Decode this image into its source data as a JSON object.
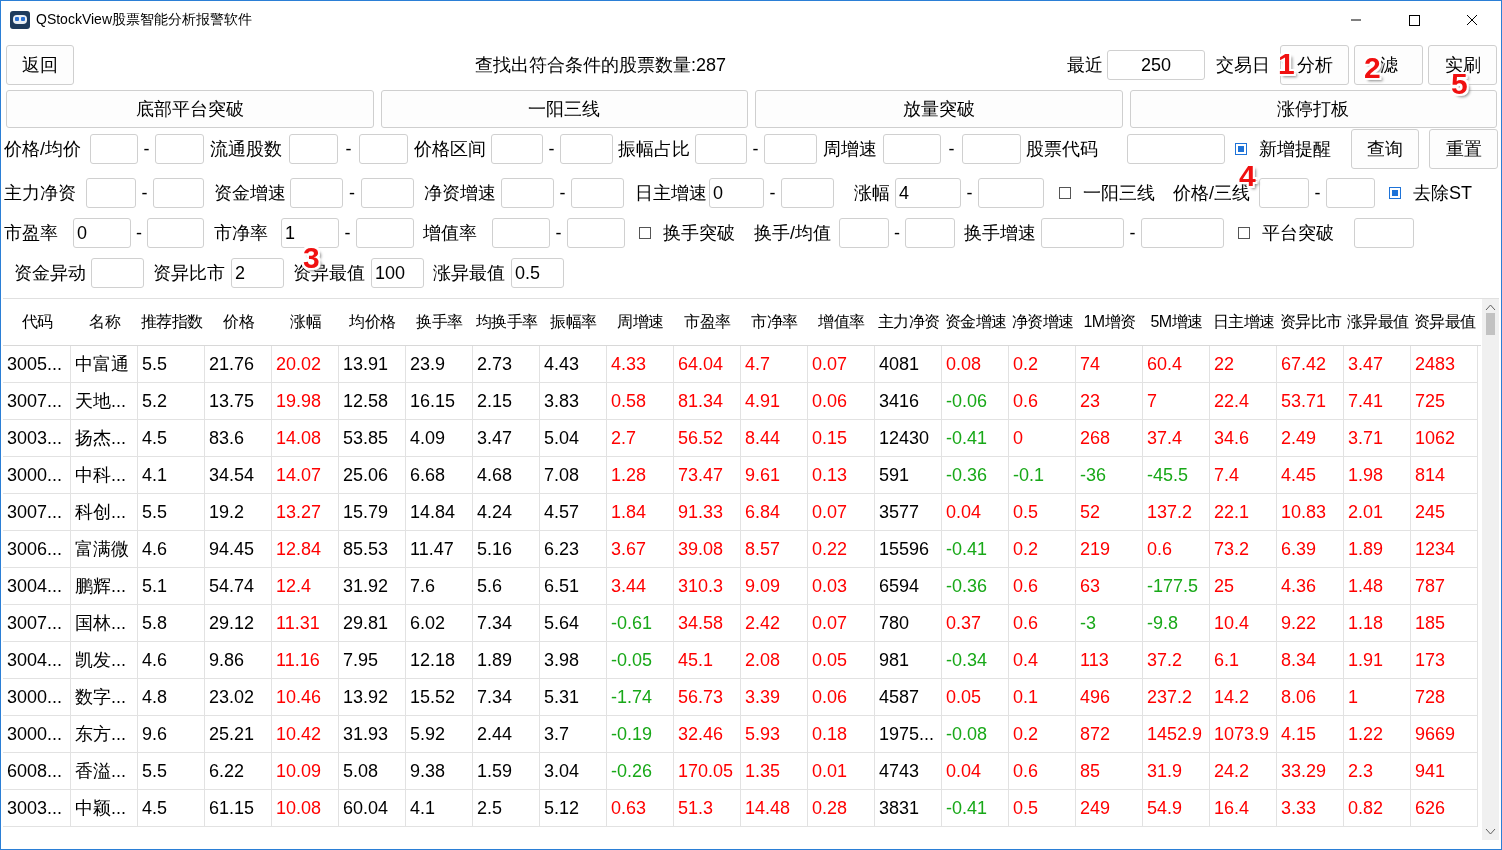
{
  "window": {
    "title": "QStockView股票智能分析报警软件"
  },
  "toolbar": {
    "back": "返回",
    "result": "查找出符合条件的股票数量:287",
    "recent_label": "最近",
    "recent_value": "250",
    "days_label": "交易日",
    "buttons": [
      "分析",
      "滤",
      "实刷"
    ]
  },
  "strategies": [
    "底部平台突破",
    "一阳三线",
    "放量突破",
    "涨停打板"
  ],
  "filters": [
    [
      {
        "kind": "label",
        "text": "价格/均价"
      },
      {
        "kind": "field"
      },
      {
        "kind": "dash",
        "text": "-"
      },
      {
        "kind": "field"
      },
      {
        "kind": "label",
        "text": "流通股数"
      },
      {
        "kind": "field"
      },
      {
        "kind": "dash",
        "text": "-"
      },
      {
        "kind": "field"
      },
      {
        "kind": "label",
        "text": "价格区间"
      },
      {
        "kind": "field"
      },
      {
        "kind": "dash",
        "text": "-"
      },
      {
        "kind": "field"
      },
      {
        "kind": "label",
        "text": "振幅占比"
      },
      {
        "kind": "field"
      },
      {
        "kind": "dash",
        "text": "-"
      },
      {
        "kind": "field"
      },
      {
        "kind": "label",
        "text": "周增速"
      },
      {
        "kind": "field"
      },
      {
        "kind": "dash",
        "text": "-"
      },
      {
        "kind": "field"
      },
      {
        "kind": "label",
        "text": "股票代码"
      },
      {
        "kind": "field"
      },
      {
        "kind": "check",
        "text": "新增提醒",
        "checked": true
      },
      {
        "kind": "button",
        "text": "查询"
      },
      {
        "kind": "button",
        "text": "重置"
      }
    ],
    [
      {
        "kind": "label",
        "text": "主力净资"
      },
      {
        "kind": "field"
      },
      {
        "kind": "dash",
        "text": "-"
      },
      {
        "kind": "field"
      },
      {
        "kind": "label",
        "text": "资金增速"
      },
      {
        "kind": "field"
      },
      {
        "kind": "dash",
        "text": "-"
      },
      {
        "kind": "field"
      },
      {
        "kind": "label",
        "text": "净资增速"
      },
      {
        "kind": "field"
      },
      {
        "kind": "dash",
        "text": "-"
      },
      {
        "kind": "field"
      },
      {
        "kind": "label",
        "text": "日主增速"
      },
      {
        "kind": "field",
        "value": "0"
      },
      {
        "kind": "dash",
        "text": "-"
      },
      {
        "kind": "field"
      },
      {
        "kind": "label",
        "text": "涨幅"
      },
      {
        "kind": "field",
        "value": "4"
      },
      {
        "kind": "dash",
        "text": "-"
      },
      {
        "kind": "field"
      },
      {
        "kind": "check",
        "text": "一阳三线",
        "checked": false
      },
      {
        "kind": "label",
        "text": "价格/三线"
      },
      {
        "kind": "field"
      },
      {
        "kind": "dash",
        "text": "-"
      },
      {
        "kind": "field"
      },
      {
        "kind": "check",
        "text": "去除ST",
        "checked": true
      }
    ],
    [
      {
        "kind": "label",
        "text": "市盈率"
      },
      {
        "kind": "field",
        "value": "0"
      },
      {
        "kind": "dash",
        "text": "-"
      },
      {
        "kind": "field"
      },
      {
        "kind": "label",
        "text": "市净率"
      },
      {
        "kind": "field",
        "value": "1"
      },
      {
        "kind": "dash",
        "text": "-"
      },
      {
        "kind": "field"
      },
      {
        "kind": "label",
        "text": "增值率"
      },
      {
        "kind": "field"
      },
      {
        "kind": "dash",
        "text": "-"
      },
      {
        "kind": "field"
      },
      {
        "kind": "check",
        "text": "换手突破",
        "checked": false
      },
      {
        "kind": "label",
        "text": "换手/均值"
      },
      {
        "kind": "field"
      },
      {
        "kind": "dash",
        "text": "-"
      },
      {
        "kind": "field"
      },
      {
        "kind": "label",
        "text": "换手增速"
      },
      {
        "kind": "field"
      },
      {
        "kind": "dash",
        "text": "-"
      },
      {
        "kind": "field"
      },
      {
        "kind": "check",
        "text": "平台突破",
        "checked": false
      },
      {
        "kind": "field"
      }
    ],
    [
      {
        "kind": "label",
        "text": "资金异动"
      },
      {
        "kind": "field"
      },
      {
        "kind": "label",
        "text": "资异比市"
      },
      {
        "kind": "field",
        "value": "2"
      },
      {
        "kind": "label",
        "text": "资异最值"
      },
      {
        "kind": "field",
        "value": "100"
      },
      {
        "kind": "label",
        "text": "涨异最值"
      },
      {
        "kind": "field",
        "value": "0.5"
      }
    ]
  ],
  "table": {
    "columns": [
      {
        "label": "代码",
        "kind": "plain"
      },
      {
        "label": "名称",
        "kind": "plain"
      },
      {
        "label": "推荐指数",
        "kind": "plain"
      },
      {
        "label": "价格",
        "kind": "plain"
      },
      {
        "label": "涨幅",
        "kind": "signed"
      },
      {
        "label": "均价格",
        "kind": "plain"
      },
      {
        "label": "换手率",
        "kind": "plain"
      },
      {
        "label": "均换手率",
        "kind": "plain"
      },
      {
        "label": "振幅率",
        "kind": "plain"
      },
      {
        "label": "周增速",
        "kind": "signed"
      },
      {
        "label": "市盈率",
        "kind": "signed"
      },
      {
        "label": "市净率",
        "kind": "signed"
      },
      {
        "label": "增值率",
        "kind": "signed"
      },
      {
        "label": "主力净资",
        "kind": "plain"
      },
      {
        "label": "资金增速",
        "kind": "signed"
      },
      {
        "label": "净资增速",
        "kind": "signed"
      },
      {
        "label": "1M增资",
        "kind": "signed"
      },
      {
        "label": "5M增速",
        "kind": "signed"
      },
      {
        "label": "日主增速",
        "kind": "signed"
      },
      {
        "label": "资异比市",
        "kind": "signed"
      },
      {
        "label": "涨异最值",
        "kind": "signed"
      },
      {
        "label": "资异最值",
        "kind": "signed"
      }
    ],
    "rows": [
      [
        "3005...",
        "中富通",
        "5.5",
        "21.76",
        "20.02",
        "13.91",
        "23.9",
        "2.73",
        "4.43",
        "4.33",
        "64.04",
        "4.7",
        "0.07",
        "4081",
        "0.08",
        "0.2",
        "74",
        "60.4",
        "22",
        "67.42",
        "3.47",
        "2483"
      ],
      [
        "3007...",
        "天地...",
        "5.2",
        "13.75",
        "19.98",
        "12.58",
        "16.15",
        "2.15",
        "3.83",
        "0.58",
        "81.34",
        "4.91",
        "0.06",
        "3416",
        "-0.06",
        "0.6",
        "23",
        "7",
        "22.4",
        "53.71",
        "7.41",
        "725"
      ],
      [
        "3003...",
        "扬杰...",
        "4.5",
        "83.6",
        "14.08",
        "53.85",
        "4.09",
        "3.47",
        "5.04",
        "2.7",
        "56.52",
        "8.44",
        "0.15",
        "12430",
        "-0.41",
        "0",
        "268",
        "37.4",
        "34.6",
        "2.49",
        "3.71",
        "1062"
      ],
      [
        "3000...",
        "中科...",
        "4.1",
        "34.54",
        "14.07",
        "25.06",
        "6.68",
        "4.68",
        "7.08",
        "1.28",
        "73.47",
        "9.61",
        "0.13",
        "591",
        "-0.36",
        "-0.1",
        "-36",
        "-45.5",
        "7.4",
        "4.45",
        "1.98",
        "814"
      ],
      [
        "3007...",
        "科创...",
        "5.5",
        "19.2",
        "13.27",
        "15.79",
        "14.84",
        "4.24",
        "4.57",
        "1.84",
        "91.33",
        "6.84",
        "0.07",
        "3577",
        "0.04",
        "0.5",
        "52",
        "137.2",
        "22.1",
        "10.83",
        "2.01",
        "245"
      ],
      [
        "3006...",
        "富满微",
        "4.6",
        "94.45",
        "12.84",
        "85.53",
        "11.47",
        "5.16",
        "6.23",
        "3.67",
        "39.08",
        "8.57",
        "0.22",
        "15596",
        "-0.41",
        "0.2",
        "219",
        "0.6",
        "73.2",
        "6.39",
        "1.89",
        "1234"
      ],
      [
        "3004...",
        "鹏辉...",
        "5.1",
        "54.74",
        "12.4",
        "31.92",
        "7.6",
        "5.6",
        "6.51",
        "3.44",
        "310.3",
        "9.09",
        "0.03",
        "6594",
        "-0.36",
        "0.6",
        "63",
        "-177.5",
        "25",
        "4.36",
        "1.48",
        "787"
      ],
      [
        "3007...",
        "国林...",
        "5.8",
        "29.12",
        "11.31",
        "29.81",
        "6.02",
        "7.34",
        "5.64",
        "-0.61",
        "34.58",
        "2.42",
        "0.07",
        "780",
        "0.37",
        "0.6",
        "-3",
        "-9.8",
        "10.4",
        "9.22",
        "1.18",
        "185"
      ],
      [
        "3004...",
        "凯发...",
        "4.6",
        "9.86",
        "11.16",
        "7.95",
        "12.18",
        "1.89",
        "3.98",
        "-0.05",
        "45.1",
        "2.08",
        "0.05",
        "981",
        "-0.34",
        "0.4",
        "113",
        "37.2",
        "6.1",
        "8.34",
        "1.91",
        "173"
      ],
      [
        "3000...",
        "数字...",
        "4.8",
        "23.02",
        "10.46",
        "13.92",
        "15.52",
        "7.34",
        "5.31",
        "-1.74",
        "56.73",
        "3.39",
        "0.06",
        "4587",
        "0.05",
        "0.1",
        "496",
        "237.2",
        "14.2",
        "8.06",
        "1",
        "728"
      ],
      [
        "3000...",
        "东方...",
        "9.6",
        "25.21",
        "10.42",
        "31.93",
        "5.92",
        "2.44",
        "3.7",
        "-0.19",
        "32.46",
        "5.93",
        "0.18",
        "1975...",
        "-0.08",
        "0.2",
        "872",
        "1452.9",
        "1073.9",
        "4.15",
        "1.22",
        "9669"
      ],
      [
        "6008...",
        "香溢...",
        "5.5",
        "6.22",
        "10.09",
        "5.08",
        "9.38",
        "1.59",
        "3.04",
        "-0.26",
        "170.05",
        "1.35",
        "0.01",
        "4743",
        "0.04",
        "0.6",
        "85",
        "31.9",
        "24.2",
        "33.29",
        "2.3",
        "941"
      ],
      [
        "3003...",
        "中颖...",
        "4.5",
        "61.15",
        "10.08",
        "60.04",
        "4.1",
        "2.5",
        "5.12",
        "0.63",
        "51.3",
        "14.48",
        "0.28",
        "3831",
        "-0.41",
        "0.5",
        "249",
        "54.9",
        "16.4",
        "3.33",
        "0.82",
        "626"
      ]
    ]
  },
  "callouts": [
    "1",
    "2",
    "3",
    "4",
    "5"
  ]
}
